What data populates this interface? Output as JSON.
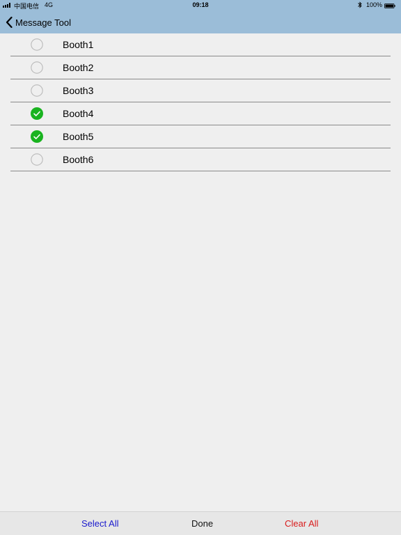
{
  "status": {
    "carrier": "中国电信",
    "network": "4G",
    "time": "09:18",
    "battery": "100%"
  },
  "nav": {
    "back_label": "Message Tool"
  },
  "booths": [
    {
      "label": "Booth1",
      "checked": false
    },
    {
      "label": "Booth2",
      "checked": false
    },
    {
      "label": "Booth3",
      "checked": false
    },
    {
      "label": "Booth4",
      "checked": true
    },
    {
      "label": "Booth5",
      "checked": true
    },
    {
      "label": "Booth6",
      "checked": false
    }
  ],
  "toolbar": {
    "select_all": "Select All",
    "done": "Done",
    "clear_all": "Clear All"
  },
  "colors": {
    "header_bg": "#9bbdd8",
    "check_green": "#19b31f",
    "select_all": "#1a1acd",
    "clear_all": "#d81b1b"
  },
  "icons": {
    "back": "chevron-left-icon",
    "checked": "checkmark-circle-icon",
    "unchecked": "empty-circle-icon",
    "bluetooth": "bluetooth-icon",
    "battery": "battery-icon",
    "signal": "signal-bars-icon"
  }
}
